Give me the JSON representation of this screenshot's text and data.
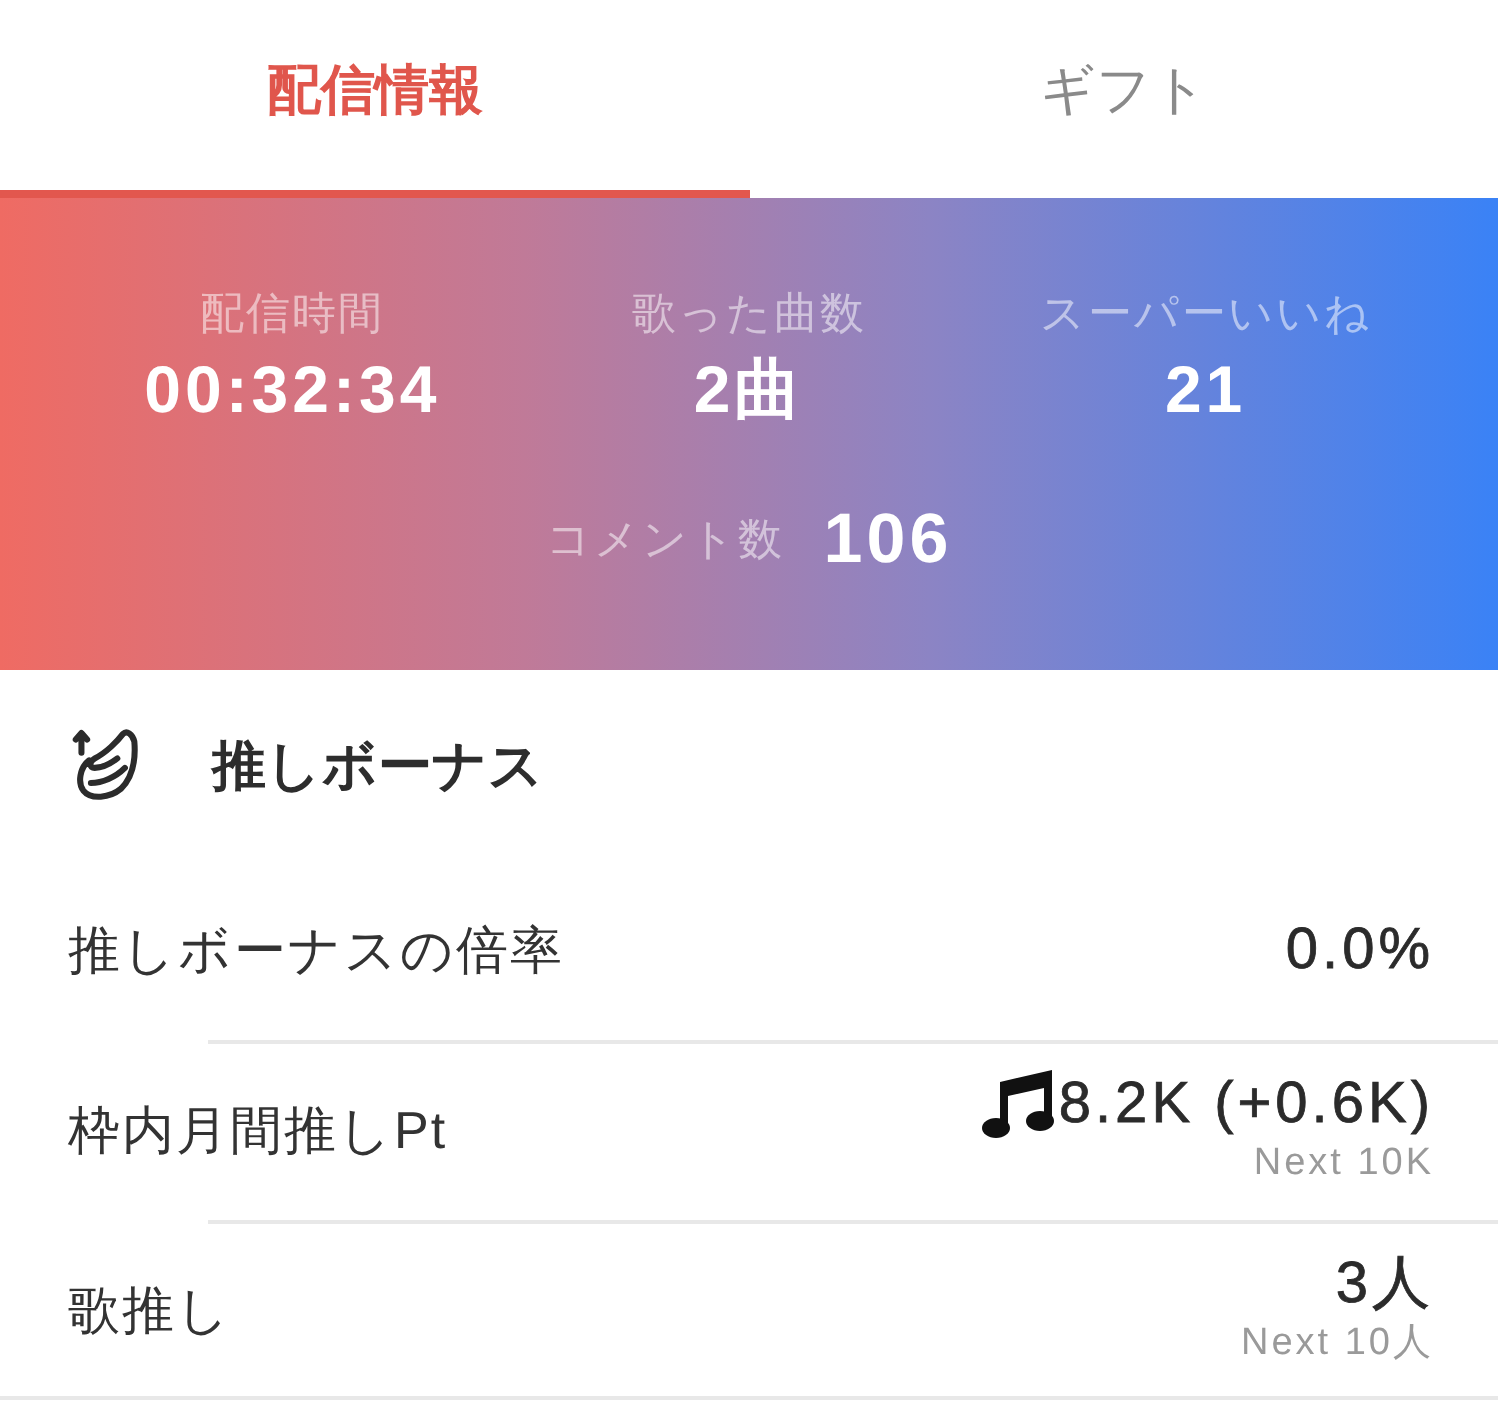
{
  "tabs": [
    {
      "label": "配信情報",
      "selected": true
    },
    {
      "label": "ギフト",
      "selected": false
    }
  ],
  "stats": [
    {
      "label": "配信時間",
      "value": "00:32:34"
    },
    {
      "label": "歌った曲数",
      "value": "2曲"
    },
    {
      "label": "スーパーいいね",
      "value": "21"
    }
  ],
  "comment_stat": {
    "label": "コメント数",
    "value": "106"
  },
  "bonus_section": {
    "title": "推しボーナス",
    "rows": [
      {
        "kind": "plain",
        "label": "推しボーナスの倍率",
        "value": "0.0%"
      },
      {
        "kind": "points",
        "label": "枠内月間推しPt",
        "value": "8.2K (+0.6K)",
        "note": "Next 10K"
      },
      {
        "kind": "plain",
        "label": "歌推し",
        "value": "3人",
        "note": "Next 10人"
      }
    ]
  }
}
